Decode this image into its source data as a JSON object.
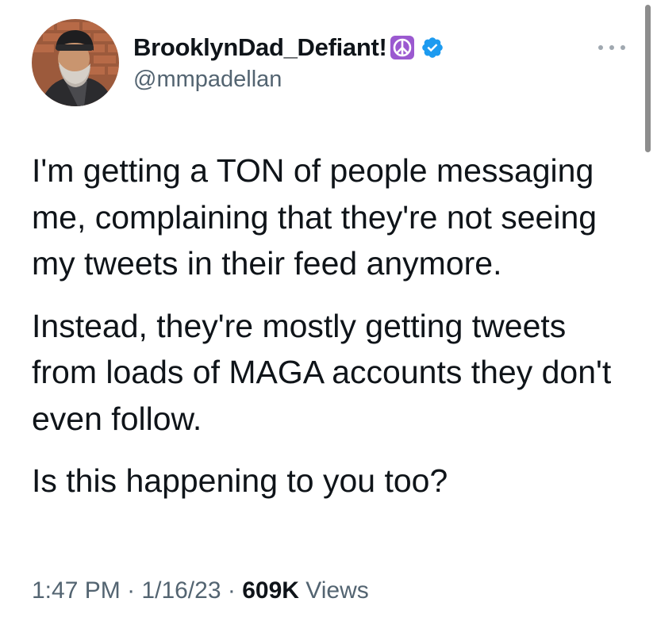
{
  "author": {
    "display_name": "BrooklynDad_Defiant!",
    "handle": "@mmpadellan",
    "badges": [
      "peace-symbol-emoji",
      "verified-badge"
    ],
    "verified_color": "#1d9bf0",
    "peace_badge_color": "#9b59d0"
  },
  "tweet": {
    "paragraphs": [
      "I'm getting a TON of people messaging me, complaining that they're not seeing my tweets in their feed anymore.",
      "Instead, they're mostly getting tweets from loads of MAGA accounts they don't even follow.",
      "Is this happening to you too?"
    ]
  },
  "meta": {
    "time": "1:47 PM",
    "separator": "·",
    "date": "1/16/23",
    "views_count": "609K",
    "views_label": "Views"
  },
  "actions": {
    "more_icon": "more-horizontal-icon"
  }
}
